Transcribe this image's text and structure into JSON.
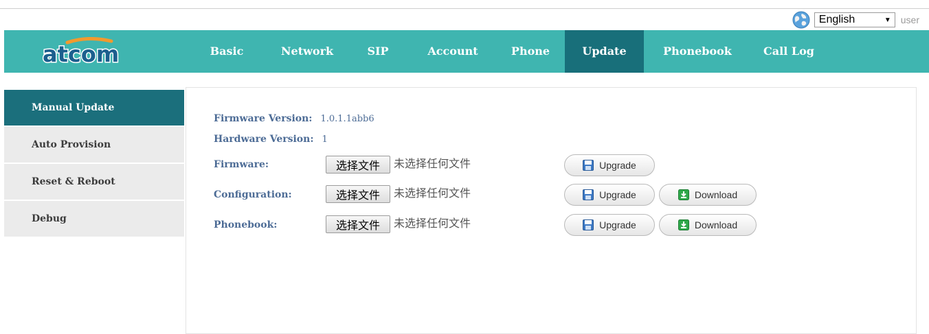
{
  "topbar": {
    "language": "English",
    "user": "user"
  },
  "brand": {
    "logo_text": "atcom"
  },
  "nav": {
    "items": [
      {
        "label": "Basic"
      },
      {
        "label": "Network"
      },
      {
        "label": "SIP"
      },
      {
        "label": "Account"
      },
      {
        "label": "Phone"
      },
      {
        "label": "Update",
        "active": true
      },
      {
        "label": "Phonebook"
      },
      {
        "label": "Call Log"
      }
    ]
  },
  "sidebar": {
    "items": [
      {
        "label": "Manual Update",
        "active": true
      },
      {
        "label": "Auto Provision"
      },
      {
        "label": "Reset & Reboot"
      },
      {
        "label": "Debug"
      }
    ]
  },
  "main": {
    "firmware_version": {
      "label": "Firmware Version:",
      "value": "1.0.1.1abb6"
    },
    "hardware_version": {
      "label": "Hardware Version:",
      "value": "1"
    },
    "rows": [
      {
        "label": "Firmware:",
        "file_button": "选择文件",
        "file_status": "未选择任何文件",
        "upgrade": "Upgrade"
      },
      {
        "label": "Configuration:",
        "file_button": "选择文件",
        "file_status": "未选择任何文件",
        "upgrade": "Upgrade",
        "download": "Download"
      },
      {
        "label": "Phonebook:",
        "file_button": "选择文件",
        "file_status": "未选择任何文件",
        "upgrade": "Upgrade",
        "download": "Download"
      }
    ]
  },
  "colors": {
    "header": "#3fb5b0",
    "nav_active": "#186f7a",
    "sidebar_active": "#1b6f7c",
    "label_text": "#4d6c96"
  },
  "icons": {
    "language": "globe-icon",
    "upgrade": "floppy-save-icon",
    "download": "green-download-icon"
  }
}
